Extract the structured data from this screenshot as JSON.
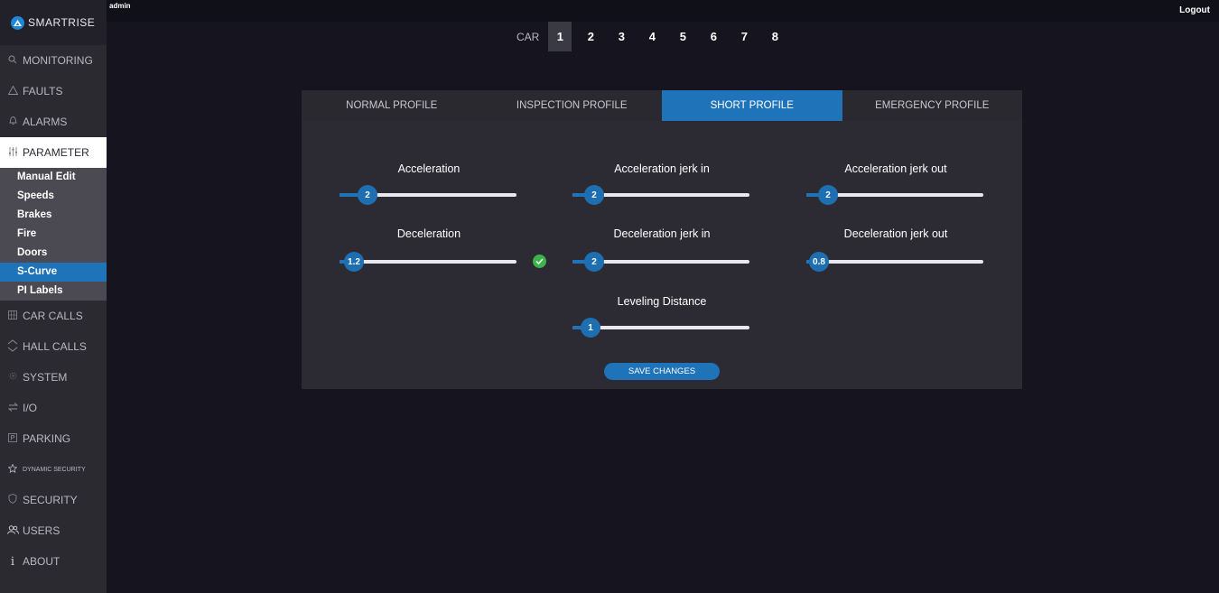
{
  "brand": {
    "name": "SMARTRISE",
    "color": "#1e88d6"
  },
  "topbar": {
    "user": "admin",
    "logout_label": "Logout"
  },
  "sidebar": {
    "items": [
      {
        "label": "MONITORING",
        "icon": "search-icon"
      },
      {
        "label": "FAULTS",
        "icon": "warning-icon"
      },
      {
        "label": "ALARMS",
        "icon": "bell-icon"
      },
      {
        "label": "PARAMETER",
        "icon": "sliders-icon"
      },
      {
        "label": "CAR CALLS",
        "icon": "keypad-icon"
      },
      {
        "label": "HALL CALLS",
        "icon": "up-down-icon"
      },
      {
        "label": "SYSTEM",
        "icon": "gear-icon"
      },
      {
        "label": "I/O",
        "icon": "swap-icon"
      },
      {
        "label": "PARKING",
        "icon": "parking-icon"
      },
      {
        "label": "DYNAMIC SECURITY",
        "icon": "star-icon"
      },
      {
        "label": "SECURITY",
        "icon": "shield-icon"
      },
      {
        "label": "USERS",
        "icon": "users-icon"
      },
      {
        "label": "ABOUT",
        "icon": "info-icon"
      }
    ],
    "submenu": [
      "Manual Edit",
      "Speeds",
      "Brakes",
      "Fire",
      "Doors",
      "S-Curve",
      "PI Labels"
    ],
    "active_submenu": "S-Curve"
  },
  "car_selector": {
    "label": "CAR",
    "cars": [
      "1",
      "2",
      "3",
      "4",
      "5",
      "6",
      "7",
      "8"
    ],
    "selected": "1"
  },
  "tabs": [
    "NORMAL PROFILE",
    "INSPECTION PROFILE",
    "SHORT PROFILE",
    "EMERGENCY PROFILE"
  ],
  "active_tab": "SHORT PROFILE",
  "sliders": {
    "acceleration": {
      "label": "Acceleration",
      "value": "2",
      "fraction": 0.16
    },
    "accel_jerk_in": {
      "label": "Acceleration jerk in",
      "value": "2",
      "fraction": 0.12
    },
    "accel_jerk_out": {
      "label": "Acceleration jerk out",
      "value": "2",
      "fraction": 0.12
    },
    "deceleration": {
      "label": "Deceleration",
      "value": "1.2",
      "fraction": 0.08
    },
    "decel_jerk_in": {
      "label": "Deceleration jerk in",
      "value": "2",
      "fraction": 0.12
    },
    "decel_jerk_out": {
      "label": "Deceleration jerk out",
      "value": "0.8",
      "fraction": 0.07
    },
    "leveling": {
      "label": "Leveling Distance",
      "value": "1",
      "fraction": 0.1
    }
  },
  "save_label": "SAVE CHANGES",
  "colors": {
    "accent": "#1e73b9",
    "panel": "#2c2b33",
    "background": "#15141f",
    "success": "#3cb44b"
  }
}
